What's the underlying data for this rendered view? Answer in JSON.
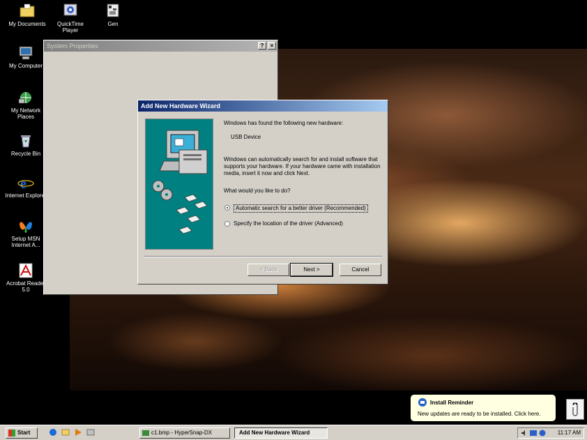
{
  "desktop": {
    "icons": [
      {
        "label": "My Documents"
      },
      {
        "label": "QuickTime Player"
      },
      {
        "label": "Gen"
      },
      {
        "label": "My Computer"
      },
      {
        "label": "My Network Places"
      },
      {
        "label": "Recycle Bin"
      },
      {
        "label": "Internet Explorer"
      },
      {
        "label": "Setup MSN Internet A..."
      },
      {
        "label": "Acrobat Reader 5.0"
      }
    ]
  },
  "system_properties": {
    "title": "System Properties",
    "help_btn": "?",
    "close_btn": "×"
  },
  "wizard": {
    "title": "Add New Hardware Wizard",
    "found_text": "Windows has found the following new hardware:",
    "device": "USB Device",
    "search_text": "Windows can automatically search for and install software that supports your hardware. If your hardware came with installation media, insert it now and click Next.",
    "question": "What would you like to do?",
    "option_auto": "Automatic search for a better driver (Recommended)",
    "option_manual": "Specify the location of the driver (Advanced)",
    "back_label": "< Back",
    "next_label": "Next >",
    "cancel_label": "Cancel"
  },
  "taskbar": {
    "start_label": "Start",
    "tasks": [
      {
        "label": "c1.bmp - HyperSnap-DX"
      },
      {
        "label": "Add New Hardware Wizard"
      }
    ],
    "clock": "11:17 AM"
  },
  "balloon": {
    "title": "Install Reminder",
    "message": "New updates are ready to be installed. Click here."
  },
  "colors": {
    "wizard_title": "#0a246a",
    "wizard_panel": "#008080",
    "face": "#d4d0c8",
    "balloon_bg": "#ffffe1"
  }
}
